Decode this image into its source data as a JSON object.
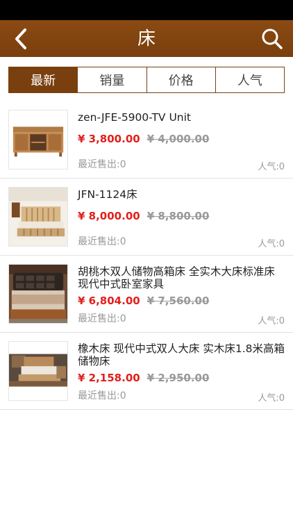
{
  "header": {
    "title": "床"
  },
  "tabs": [
    "最新",
    "销量",
    "价格",
    "人气"
  ],
  "currency": "¥",
  "products": [
    {
      "name": "zen-JFE-5900-TV Unit",
      "price": "3,800.00",
      "old_price": "4,000.00",
      "sold": "最近售出:0",
      "popularity": "人气:0",
      "image": "tv-cabinet"
    },
    {
      "name": "JFN-1124床",
      "price": "8,000.00",
      "old_price": "8,800.00",
      "sold": "最近售出:0",
      "popularity": "人气:0",
      "image": "wooden-bed"
    },
    {
      "name": "胡桃木双人储物高箱床 全实木大床标准床 现代中式卧室家具",
      "price": "6,804.00",
      "old_price": "7,560.00",
      "sold": "最近售出:0",
      "popularity": "人气:0",
      "image": "leather-headboard-bed"
    },
    {
      "name": "橡木床 现代中式双人大床 实木床1.8米高箱储物床",
      "price": "2,158.00",
      "old_price": "2,950.00",
      "sold": "最近售出:0",
      "popularity": "人气:0",
      "image": "oak-bed"
    }
  ]
}
